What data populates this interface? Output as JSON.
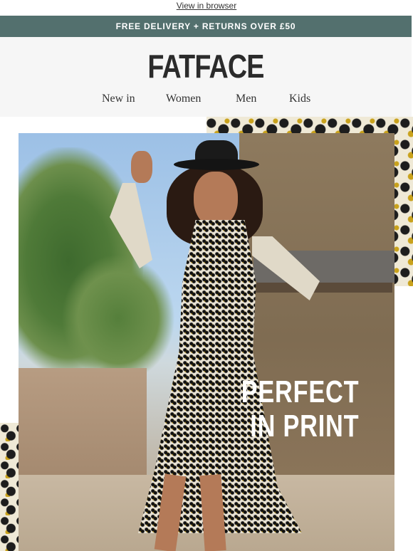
{
  "top": {
    "view_in_browser": "View in browser"
  },
  "banner": {
    "text": "FREE DELIVERY + RETURNS OVER £50",
    "color": "#53706e"
  },
  "header": {
    "logo": "FATFACE"
  },
  "nav": {
    "items": [
      "New in",
      "Women",
      "Men",
      "Kids"
    ]
  },
  "hero": {
    "headline_line1": "PERFECT",
    "headline_line2": "IN PRINT",
    "image": "woman-in-printed-dress-photo"
  }
}
